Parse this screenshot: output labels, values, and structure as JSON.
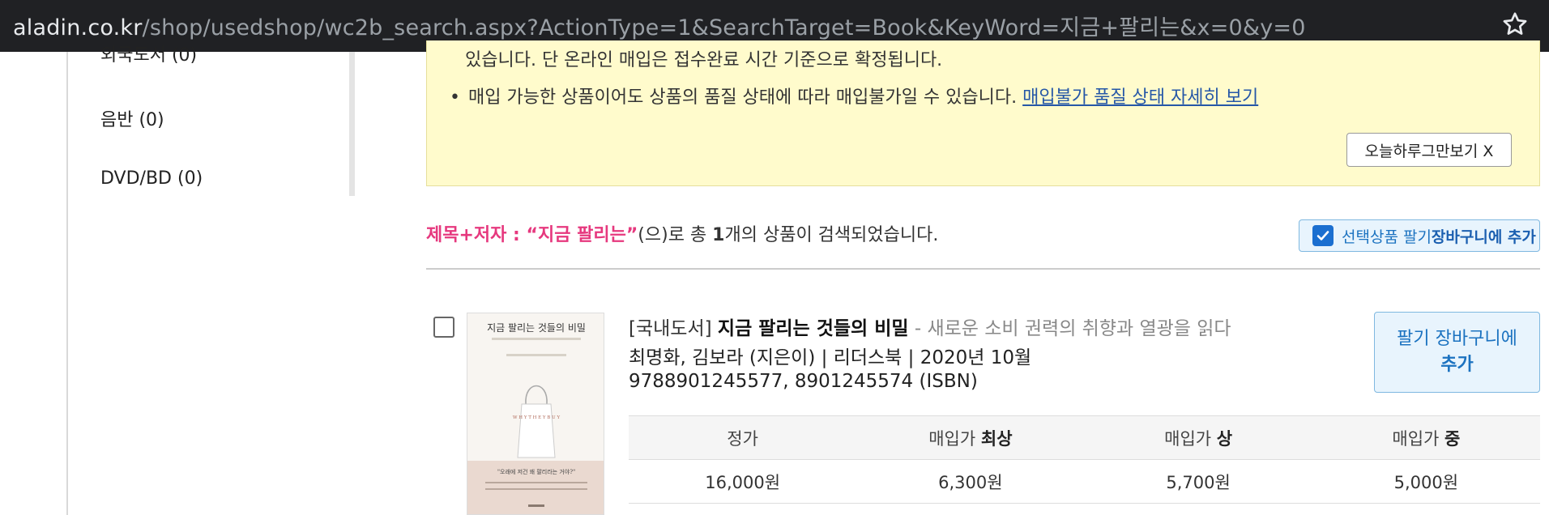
{
  "browser": {
    "url_host": "aladin.co.kr",
    "url_path": "/shop/usedshop/wc2b_search.aspx?ActionType=1&SearchTarget=Book&KeyWord=지금+팔리는&x=0&y=0",
    "bookmark_icon": "star-icon"
  },
  "sidebar": {
    "items": [
      {
        "label": "외국도서 (0)"
      },
      {
        "label": "음반 (0)"
      },
      {
        "label": "DVD/BD (0)"
      }
    ]
  },
  "notice": {
    "line1": "있습니다. 단 온라인 매입은 접수완료 시간 기준으로 확정됩니다.",
    "bullet": "•",
    "line2": "매입 가능한 상품이어도 상품의 품질 상태에 따라 매입불가일 수 있습니다.",
    "link": "매입불가 품질 상태 자세히 보기",
    "dismiss_label": "오늘하루그만보기 X"
  },
  "search": {
    "highlight": "제목+저자 : “지금 팔리는”",
    "text_before_count": "(으)로 총 ",
    "count": "1",
    "text_after_count": "개의 상품이 검색되었습니다.",
    "add_selected_prefix": "선택상품 팔기 ",
    "add_selected_bold": "장바구니에 추가"
  },
  "product": {
    "category": "[국내도서]",
    "title": "지금 팔리는 것들의 비밀",
    "subtitle": " - 새로운 소비 권력의 취향과 열광을 읽다",
    "authors": "최명화, 김보라 (지은이) | 리더스북 | 2020년 10월",
    "isbn": "9788901245577, 8901245574 (ISBN)",
    "cover": {
      "title": "지금 팔리는 것들의 비밀",
      "bag_text": "W H Y   T H E Y   B U Y",
      "quote": "\"오래에 저건 왜 팔리라는 거야?\""
    },
    "sell_button_line1": "팔기 장바구니에",
    "sell_button_line2": "추가",
    "price_headers": [
      {
        "prefix": "정가",
        "bold": ""
      },
      {
        "prefix": "매입가 ",
        "bold": "최상"
      },
      {
        "prefix": "매입가 ",
        "bold": "상"
      },
      {
        "prefix": "매입가 ",
        "bold": "중"
      }
    ],
    "prices": [
      "16,000원",
      "6,300원",
      "5,700원",
      "5,000원"
    ]
  },
  "colors": {
    "highlight": "#e6387e",
    "notice_bg": "#fffbcc",
    "link": "#2557a7",
    "cart_button_bg": "#e8f4fd",
    "cart_button_text": "#1b72c0",
    "checkbox_checked": "#1b6fd0"
  }
}
